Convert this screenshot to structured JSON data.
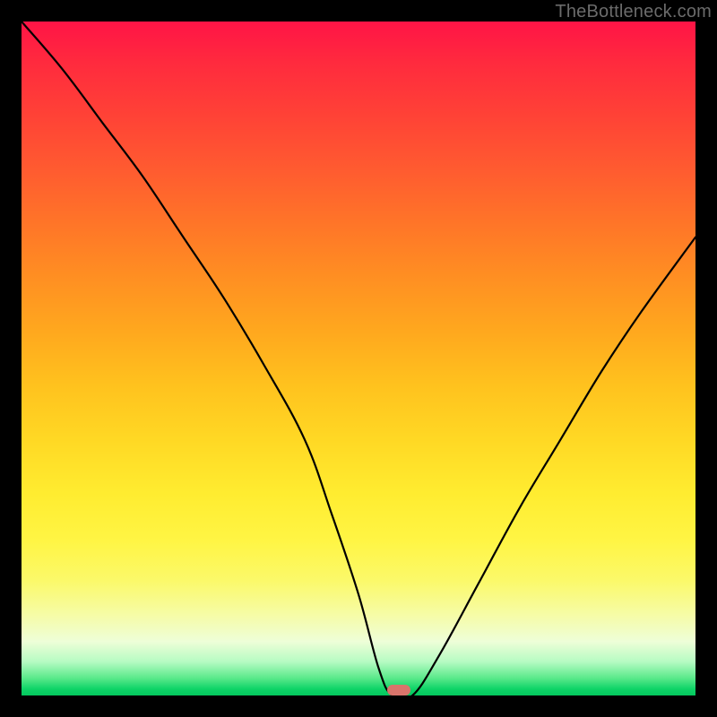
{
  "watermark": "TheBottleneck.com",
  "colors": {
    "frame": "#000000",
    "marker": "#d9746b",
    "curve": "#000000"
  },
  "chart_data": {
    "type": "line",
    "title": "",
    "xlabel": "",
    "ylabel": "",
    "xlim": [
      0,
      100
    ],
    "ylim": [
      0,
      100
    ],
    "grid": false,
    "legend": false,
    "series": [
      {
        "name": "bottleneck-curve",
        "x": [
          0,
          6,
          12,
          18,
          24,
          30,
          36,
          42,
          46,
          50,
          53,
          55,
          58,
          62,
          68,
          74,
          80,
          86,
          92,
          100
        ],
        "y": [
          100,
          93,
          85,
          77,
          68,
          59,
          49,
          38,
          27,
          15,
          4,
          0,
          0,
          6,
          17,
          28,
          38,
          48,
          57,
          68
        ]
      }
    ],
    "annotations": [
      {
        "name": "optimal-marker",
        "x": 56,
        "y": 0.8
      }
    ],
    "background_gradient": {
      "direction": "vertical",
      "stops": [
        {
          "pos": 0,
          "color": "#ff1446"
        },
        {
          "pos": 50,
          "color": "#ffb81e"
        },
        {
          "pos": 80,
          "color": "#fff544"
        },
        {
          "pos": 100,
          "color": "#04c85e"
        }
      ]
    }
  }
}
